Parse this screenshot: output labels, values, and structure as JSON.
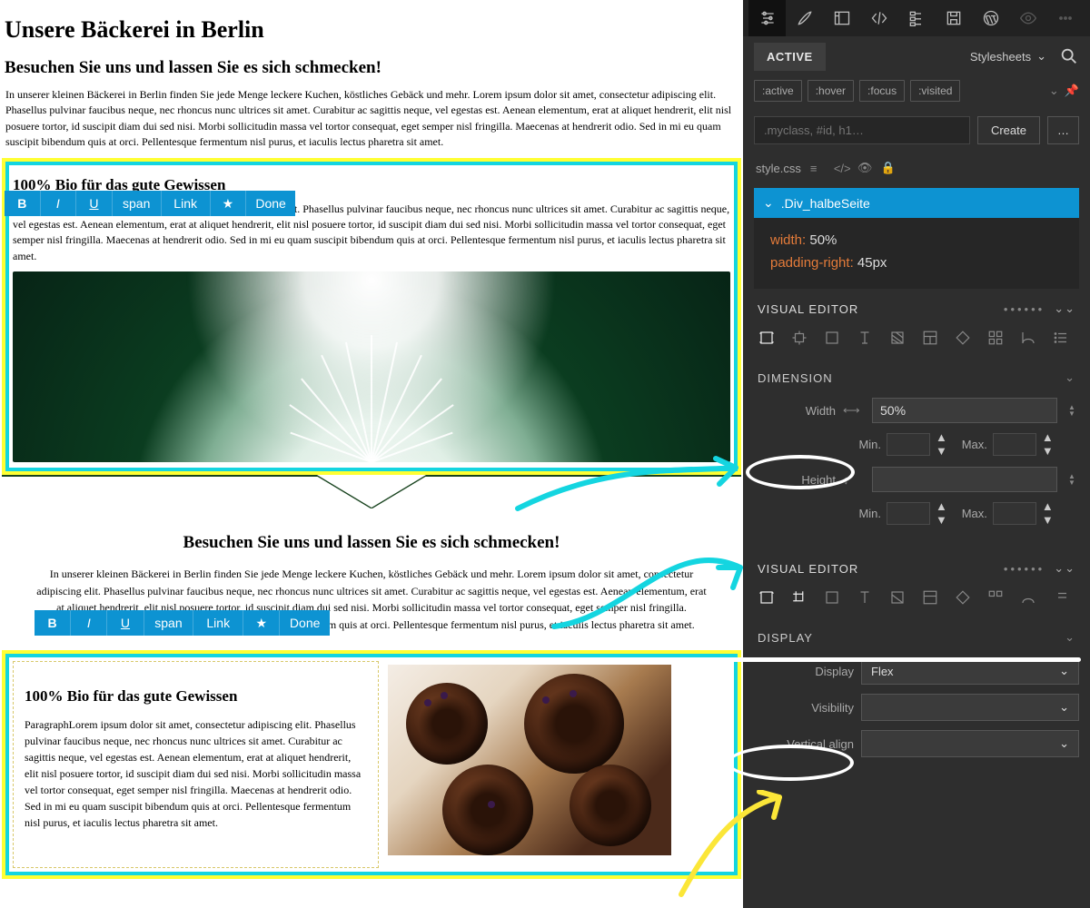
{
  "page": {
    "h1": "Unsere Bäckerei in Berlin",
    "h2": "Besuchen Sie uns und lassen Sie es sich schmecken!",
    "intro": "In unserer kleinen Bäckerei in Berlin finden Sie jede Menge leckere Kuchen, köstliches Gebäck und mehr.  Lorem ipsum dolor sit amet, consectetur adipiscing elit. Phasellus pulvinar faucibus neque, nec rhoncus nunc ultrices sit amet. Curabitur ac sagittis neque, vel egestas est. Aenean elementum, erat at aliquet hendrerit, elit nisl posuere tortor, id suscipit diam dui sed nisi. Morbi sollicitudin massa vel tortor consequat, eget semper nisl fringilla. Maecenas at hendrerit odio. Sed in mi eu quam suscipit bibendum quis at orci. Pellentesque fermentum nisl purus, et iaculis lectus pharetra sit amet.",
    "bio_h3": "100% Bio für das gute Gewissen",
    "bio_p": "ParagraphLorem ipsum dolor sit amet, consectetur adipiscing elit. Phasellus pulvinar faucibus neque, nec rhoncus nunc ultrices sit amet. Curabitur ac sagittis neque, vel egestas est. Aenean elementum, erat at aliquet hendrerit, elit nisl posuere tortor, id suscipit diam dui sed nisi. Morbi sollicitudin massa vel tortor consequat, eget semper nisl fringilla. Maecenas at hendrerit odio. Sed in mi eu quam suscipit bibendum quis at orci. Pellentesque fermentum nisl purus, et iaculis lectus pharetra sit amet.",
    "center_h2": "Besuchen Sie uns und lassen Sie es sich schmecken!",
    "center_p": "In unserer kleinen Bäckerei in Berlin finden Sie jede Menge leckere Kuchen, köstliches Gebäck und mehr.  Lorem ipsum dolor sit amet, consectetur adipiscing elit. Phasellus pulvinar faucibus neque, nec rhoncus nunc ultrices sit amet. Curabitur ac sagittis neque, vel egestas est. Aenean elementum, erat at aliquet hendrerit, elit nisl posuere tortor, id suscipit diam dui sed nisi. Morbi sollicitudin massa vel tortor consequat, eget semper nisl fringilla. Maecenas at hendrerit odio. Sed in mi eu quam suscipit bibendum quis at orci. Pellentesque fermentum nisl purus, et iaculis lectus pharetra sit amet.",
    "col_h3": "100% Bio für das gute Gewissen",
    "col_p": "ParagraphLorem ipsum dolor sit amet, consectetur adipiscing elit. Phasellus pulvinar faucibus neque, nec rhoncus nunc ultrices sit amet. Curabitur ac sagittis neque, vel egestas est. Aenean elementum, erat at aliquet hendrerit, elit nisl posuere tortor, id suscipit diam dui sed nisi. Morbi sollicitudin massa vel tortor consequat, eget semper nisl fringilla. Maecenas at hendrerit odio. Sed in mi eu quam suscipit bibendum quis at orci. Pellentesque fermentum nisl purus, et iaculis lectus pharetra sit amet."
  },
  "toolbar": {
    "b": "B",
    "i": "I",
    "u": "U",
    "span": "span",
    "link": "Link",
    "star": "★",
    "done": "Done"
  },
  "inspector": {
    "active": "ACTIVE",
    "stylesheets": "Stylesheets",
    "pseudo": {
      "active": ":active",
      "hover": ":hover",
      "focus": ":focus",
      "visited": ":visited"
    },
    "create_placeholder": ".myclass, #id, h1…",
    "create": "Create",
    "more": "…",
    "file": "style.css",
    "selector": ".Div_halbeSeite",
    "props": [
      {
        "k": "width",
        "v": "50%"
      },
      {
        "k": "padding-right",
        "v": "45px"
      }
    ],
    "visual_editor": "VISUAL EDITOR",
    "dots": "••••••",
    "dimension": "DIMENSION",
    "width_label": "Width",
    "width_value": "50%",
    "min": "Min.",
    "max": "Max.",
    "height_label": "Height",
    "display_section": "DISPLAY",
    "display_label": "Display",
    "display_value": "Flex",
    "visibility_label": "Visibility",
    "valign_label": "Vertical align"
  }
}
